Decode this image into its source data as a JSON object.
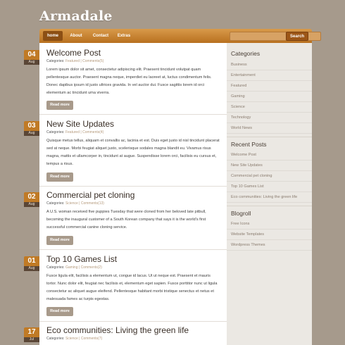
{
  "site": {
    "title": "Armadale"
  },
  "nav": {
    "items": [
      "home",
      "About",
      "Contact",
      "Extras"
    ],
    "search_button": "Search",
    "search_placeholder": ""
  },
  "posts": [
    {
      "day": "04",
      "month": "Aug",
      "title": "Welcome Post",
      "categories_label": "Categories:",
      "category": "Featured",
      "separator": "|",
      "comments": "Comments(5)",
      "body": "Lorem ipsum dolor sit amet, consectetur adipiscing elit. Praesent tincidunt volutpat quam pellentesque auctor. Praesent magna neque, imperdiet eu laoreet at, luctus condimentum felis. Donec dapibus ipsum id justo ultrices gravida. In vel auctor dui. Fusce sagittis lorem id orci elementum ac tincidunt uma viverra.",
      "read_more": "Read more"
    },
    {
      "day": "03",
      "month": "Aug",
      "title": "New Site Updates",
      "categories_label": "Categories:",
      "category": "Featured",
      "separator": "|",
      "comments": "Comments(4)",
      "body": "Quisque metus tellus, aliquam et convallis ac, lacinia et est. Duis eget justo id nisl tincidunt placerat sed at neque. Morbi feugiat aliquet justo, scelerisque sodales magna blandit eu. Vivamus risus magna, mattis et ullamcorper in, tincidunt at augue. Suspendisse lorem orci, facilisis eu cursus et, tempus a risus.",
      "read_more": "Read more"
    },
    {
      "day": "02",
      "month": "Aug",
      "title": "Commercial pet cloning",
      "categories_label": "Categories:",
      "category": "Science",
      "separator": "|",
      "comments": "Comments(13)",
      "body": "A U.S. woman received five puppies Tuesday that were cloned from her beloved late pitbull, becoming the inaugural customer of a South Korean company that says it is the world's first successful commercial canine cloning service.",
      "read_more": "Read more"
    },
    {
      "day": "01",
      "month": "Aug",
      "title": "Top 10 Games List",
      "categories_label": "Categories:",
      "category": "Gaming",
      "separator": "|",
      "comments": "Comments(2)",
      "body": "Fusce ligula elit, facilisis a elementum ut, congue id lacus. Ut ut neque est. Praesent et mauris tortor. Nunc dolor elit, feugiat nec facilisis et, elementum eget sapien. Fusce porttitor nunc ut ligula consectetur ac aliquet augue eleifend. Pellentesque habitant morbi tristique senectus et netus et malesuada fames ac turpis egestas.",
      "read_more": "Read more"
    },
    {
      "day": "17",
      "month": "Jul",
      "title": "Eco communities: Living the green life",
      "categories_label": "Categories:",
      "category": "Science",
      "separator": "|",
      "comments": "Comments(7)",
      "body": "",
      "read_more": ""
    }
  ],
  "sidebar": {
    "categories_title": "Categories",
    "categories": [
      "Business",
      "Entertainment",
      "Featured",
      "Gaming",
      "Science",
      "Technology",
      "World News"
    ],
    "recent_title": "Recent Posts",
    "recent": [
      "Welcome Post",
      "New Site Updates",
      "Commercial pet cloning",
      "Top 10 Games List",
      "Eco communities: Living the green life"
    ],
    "blogroll_title": "Blogroll",
    "blogroll": [
      "Free Icons",
      "Website Templates",
      "Wordpress Themes"
    ]
  },
  "colors": {
    "background": "#a69a8c",
    "accent": "#c07a25",
    "nav": "#b8701f",
    "content": "#ffffff",
    "sidebar": "#ebe8e3"
  }
}
